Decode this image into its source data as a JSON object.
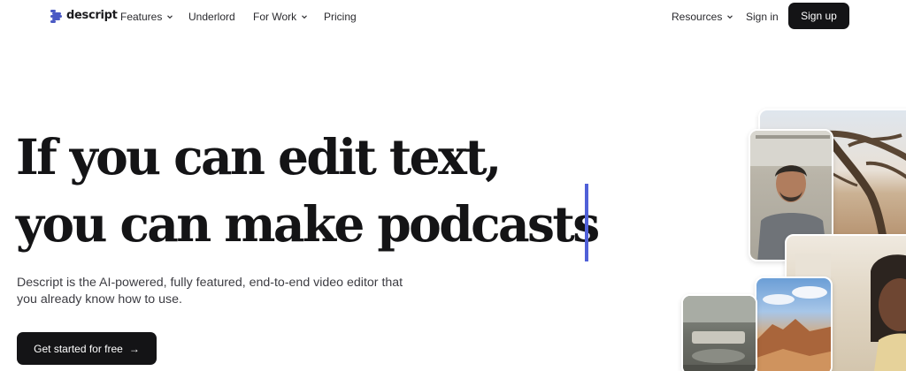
{
  "nav": {
    "logo_text": "descript",
    "items": [
      {
        "label": "Features",
        "dropdown": true
      },
      {
        "label": "Underlord",
        "dropdown": false
      },
      {
        "label": "For Work",
        "dropdown": true
      },
      {
        "label": "Pricing",
        "dropdown": false
      }
    ],
    "resources_label": "Resources",
    "signin_label": "Sign in",
    "signup_label": "Sign up"
  },
  "hero": {
    "headline_line1": "If you can edit text,",
    "headline_line2": "you can make podcasts",
    "subtext": "Descript is the AI-powered, fully featured, end-to-end video editor that you already know how to use.",
    "cta_label": "Get started for free",
    "cta_arrow": "→"
  },
  "colors": {
    "brand_accent": "#4a59c4",
    "caret": "#5060d8",
    "button_dark": "#141416"
  },
  "icons": [
    "descript-logo-icon",
    "chevron-down-icon",
    "arrow-right-icon"
  ]
}
